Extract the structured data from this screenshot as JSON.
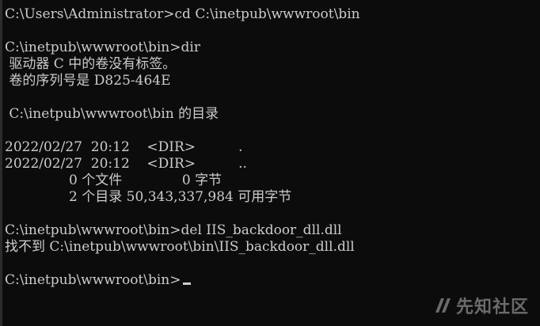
{
  "terminal": {
    "lines": [
      "C:\\Users\\Administrator>cd C:\\inetpub\\wwwroot\\bin",
      "",
      "C:\\inetpub\\wwwroot\\bin>dir",
      " 驱动器 C 中的卷没有标签。",
      " 卷的序列号是 D825-464E",
      "",
      " C:\\inetpub\\wwwroot\\bin 的目录",
      "",
      "2022/02/27  20:12    <DIR>          .",
      "2022/02/27  20:12    <DIR>          ..",
      "               0 个文件              0 字节",
      "               2 个目录 50,343,337,984 可用字节",
      "",
      "C:\\inetpub\\wwwroot\\bin>del IIS_backdoor_dll.dll",
      "找不到 C:\\inetpub\\wwwroot\\bin\\IIS_backdoor_dll.dll",
      "",
      "C:\\inetpub\\wwwroot\\bin>"
    ],
    "colors": {
      "background": "#0c0c0c",
      "foreground": "#cccccc"
    }
  },
  "watermark": {
    "text": "先知社区",
    "logo_icon": "xianzhi-logo-icon"
  }
}
